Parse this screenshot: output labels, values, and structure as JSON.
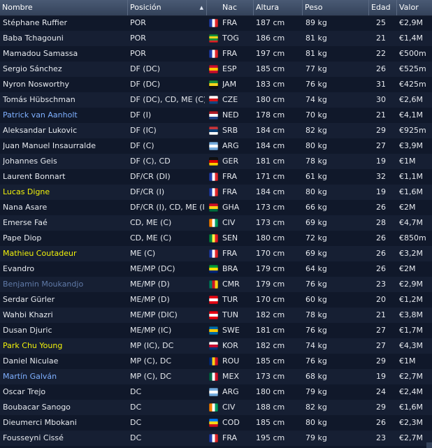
{
  "columns": {
    "name": "Nombre",
    "position": "Posición",
    "nationality": "Nac",
    "height": "Altura",
    "weight": "Peso",
    "age": "Edad",
    "value": "Valor"
  },
  "name_colors": {
    "normal": "#e6e9ee",
    "blue": "#7fb0ff",
    "yellow": "#f2f20a",
    "slate": "#607aa8"
  },
  "players": [
    {
      "name": "Stéphane Ruffier",
      "position": "POR",
      "nation": "FRA",
      "flag": [
        "#1f3da8",
        "#ffffff",
        "#e0262b"
      ],
      "flag_dir": "v",
      "height": "187 cm",
      "weight": "89 kg",
      "age": "25",
      "value": "€2,9M",
      "name_color": "normal"
    },
    {
      "name": "Baba Tchagouni",
      "position": "POR",
      "nation": "TOG",
      "flag": [
        "#1a8f3a",
        "#f6d51c",
        "#1a8f3a",
        "#d8232a"
      ],
      "flag_dir": "h",
      "height": "186 cm",
      "weight": "81 kg",
      "age": "21",
      "value": "€1,4M",
      "name_color": "normal"
    },
    {
      "name": "Mamadou Samassa",
      "position": "POR",
      "nation": "FRA",
      "flag": [
        "#1f3da8",
        "#ffffff",
        "#e0262b"
      ],
      "flag_dir": "v",
      "height": "197 cm",
      "weight": "81 kg",
      "age": "22",
      "value": "€500m",
      "name_color": "normal"
    },
    {
      "name": "Sergio Sánchez",
      "position": "DF (DC)",
      "nation": "ESP",
      "flag": [
        "#c8102e",
        "#ffc400",
        "#c8102e"
      ],
      "flag_dir": "h",
      "height": "185 cm",
      "weight": "77 kg",
      "age": "26",
      "value": "€525m",
      "name_color": "normal"
    },
    {
      "name": "Nyron Nosworthy",
      "position": "DF (DC)",
      "nation": "JAM",
      "flag": [
        "#1a8f3a",
        "#f6d51c",
        "#111111"
      ],
      "flag_dir": "h",
      "height": "183 cm",
      "weight": "76 kg",
      "age": "31",
      "value": "€425m",
      "name_color": "normal"
    },
    {
      "name": "Tomás Hübschman",
      "position": "DF (DC), CD, ME (C)",
      "nation": "CZE",
      "flag": [
        "#ffffff",
        "#d7141a",
        "#11457e"
      ],
      "flag_dir": "h",
      "height": "180 cm",
      "weight": "74 kg",
      "age": "30",
      "value": "€2,6M",
      "name_color": "normal"
    },
    {
      "name": "Patrick van Aanholt",
      "position": "DF (I)",
      "nation": "NED",
      "flag": [
        "#ae1c28",
        "#ffffff",
        "#21468b"
      ],
      "flag_dir": "h",
      "height": "178 cm",
      "weight": "70 kg",
      "age": "21",
      "value": "€4,1M",
      "name_color": "blue"
    },
    {
      "name": "Aleksandar Lukovic",
      "position": "DF (IC)",
      "nation": "SRB",
      "flag": [
        "#c6363c",
        "#0c4076",
        "#ffffff"
      ],
      "flag_dir": "h",
      "height": "184 cm",
      "weight": "82 kg",
      "age": "29",
      "value": "€925m",
      "name_color": "normal"
    },
    {
      "name": "Juan Manuel Insaurralde",
      "position": "DF (C)",
      "nation": "ARG",
      "flag": [
        "#74acdf",
        "#ffffff",
        "#74acdf"
      ],
      "flag_dir": "h",
      "height": "184 cm",
      "weight": "80 kg",
      "age": "27",
      "value": "€3,9M",
      "name_color": "normal"
    },
    {
      "name": "Johannes Geis",
      "position": "DF (C), CD",
      "nation": "GER",
      "flag": [
        "#111111",
        "#dd0000",
        "#ffce00"
      ],
      "flag_dir": "h",
      "height": "181 cm",
      "weight": "78 kg",
      "age": "19",
      "value": "€1M",
      "name_color": "normal"
    },
    {
      "name": "Laurent Bonnart",
      "position": "DF/CR (DI)",
      "nation": "FRA",
      "flag": [
        "#1f3da8",
        "#ffffff",
        "#e0262b"
      ],
      "flag_dir": "v",
      "height": "171 cm",
      "weight": "61 kg",
      "age": "32",
      "value": "€1,1M",
      "name_color": "normal"
    },
    {
      "name": "Lucas Digne",
      "position": "DF/CR (I)",
      "nation": "FRA",
      "flag": [
        "#1f3da8",
        "#ffffff",
        "#e0262b"
      ],
      "flag_dir": "v",
      "height": "184 cm",
      "weight": "80 kg",
      "age": "19",
      "value": "€1,6M",
      "name_color": "yellow"
    },
    {
      "name": "Nana Asare",
      "position": "DF/CR (I), CD, ME (I...",
      "nation": "GHA",
      "flag": [
        "#ce1126",
        "#fcd116",
        "#006b3f"
      ],
      "flag_dir": "h",
      "height": "173 cm",
      "weight": "66 kg",
      "age": "26",
      "value": "€2M",
      "name_color": "normal"
    },
    {
      "name": "Emerse Faé",
      "position": "CD, ME (C)",
      "nation": "CIV",
      "flag": [
        "#f77f00",
        "#ffffff",
        "#009e60"
      ],
      "flag_dir": "v",
      "height": "173 cm",
      "weight": "69 kg",
      "age": "28",
      "value": "€4,7M",
      "name_color": "normal"
    },
    {
      "name": "Pape Diop",
      "position": "CD, ME (C)",
      "nation": "SEN",
      "flag": [
        "#00853f",
        "#fdef42",
        "#e31b23"
      ],
      "flag_dir": "v",
      "height": "180 cm",
      "weight": "72 kg",
      "age": "26",
      "value": "€850m",
      "name_color": "normal"
    },
    {
      "name": "Mathieu Coutadeur",
      "position": "ME (C)",
      "nation": "FRA",
      "flag": [
        "#1f3da8",
        "#ffffff",
        "#e0262b"
      ],
      "flag_dir": "v",
      "height": "170 cm",
      "weight": "69 kg",
      "age": "26",
      "value": "€3,2M",
      "name_color": "yellow"
    },
    {
      "name": "Evandro",
      "position": "ME/MP (DC)",
      "nation": "BRA",
      "flag": [
        "#009c3b",
        "#ffdf00",
        "#002776"
      ],
      "flag_dir": "h",
      "height": "179 cm",
      "weight": "64 kg",
      "age": "26",
      "value": "€2M",
      "name_color": "normal"
    },
    {
      "name": "Benjamin Moukandjo",
      "position": "ME/MP (D)",
      "nation": "CMR",
      "flag": [
        "#007a5e",
        "#ce1126",
        "#fcd116"
      ],
      "flag_dir": "v",
      "height": "179 cm",
      "weight": "76 kg",
      "age": "23",
      "value": "€2,9M",
      "name_color": "slate"
    },
    {
      "name": "Serdar Gürler",
      "position": "ME/MP (D)",
      "nation": "TUR",
      "flag": [
        "#e30a17",
        "#ffffff",
        "#e30a17"
      ],
      "flag_dir": "h",
      "height": "170 cm",
      "weight": "60 kg",
      "age": "20",
      "value": "€1,2M",
      "name_color": "normal"
    },
    {
      "name": "Wahbi Khazri",
      "position": "ME/MP (DIC)",
      "nation": "TUN",
      "flag": [
        "#e70013",
        "#ffffff",
        "#e70013"
      ],
      "flag_dir": "h",
      "height": "182 cm",
      "weight": "78 kg",
      "age": "21",
      "value": "€3,8M",
      "name_color": "normal"
    },
    {
      "name": "Dusan Djuric",
      "position": "ME/MP (IC)",
      "nation": "SWE",
      "flag": [
        "#006aa7",
        "#fecc00",
        "#006aa7"
      ],
      "flag_dir": "h",
      "height": "181 cm",
      "weight": "76 kg",
      "age": "27",
      "value": "€1,7M",
      "name_color": "normal"
    },
    {
      "name": "Park Chu Young",
      "position": "MP (IC), DC",
      "nation": "KOR",
      "flag": [
        "#ffffff",
        "#c60c30",
        "#003478"
      ],
      "flag_dir": "h",
      "height": "182 cm",
      "weight": "74 kg",
      "age": "27",
      "value": "€4,3M",
      "name_color": "yellow"
    },
    {
      "name": "Daniel Niculae",
      "position": "MP (C), DC",
      "nation": "ROU",
      "flag": [
        "#002b7f",
        "#fcd116",
        "#ce1126"
      ],
      "flag_dir": "v",
      "height": "185 cm",
      "weight": "76 kg",
      "age": "29",
      "value": "€1M",
      "name_color": "normal"
    },
    {
      "name": "Martín Galván",
      "position": "MP (C), DC",
      "nation": "MEX",
      "flag": [
        "#006847",
        "#ffffff",
        "#ce1126"
      ],
      "flag_dir": "v",
      "height": "173 cm",
      "weight": "68 kg",
      "age": "19",
      "value": "€2,7M",
      "name_color": "blue"
    },
    {
      "name": "Oscar Trejo",
      "position": "DC",
      "nation": "ARG",
      "flag": [
        "#74acdf",
        "#ffffff",
        "#74acdf"
      ],
      "flag_dir": "h",
      "height": "180 cm",
      "weight": "79 kg",
      "age": "24",
      "value": "€2,4M",
      "name_color": "normal"
    },
    {
      "name": "Boubacar Sanogo",
      "position": "DC",
      "nation": "CIV",
      "flag": [
        "#f77f00",
        "#ffffff",
        "#009e60"
      ],
      "flag_dir": "v",
      "height": "188 cm",
      "weight": "82 kg",
      "age": "29",
      "value": "€1,6M",
      "name_color": "normal"
    },
    {
      "name": "Dieumerci Mbokani",
      "position": "DC",
      "nation": "COD",
      "flag": [
        "#007fff",
        "#f7d618",
        "#ce1021"
      ],
      "flag_dir": "h",
      "height": "185 cm",
      "weight": "80 kg",
      "age": "26",
      "value": "€2,3M",
      "name_color": "normal"
    },
    {
      "name": "Fousseyni Cissé",
      "position": "DC",
      "nation": "FRA",
      "flag": [
        "#1f3da8",
        "#ffffff",
        "#e0262b"
      ],
      "flag_dir": "v",
      "height": "195 cm",
      "weight": "79 kg",
      "age": "23",
      "value": "€2,7M",
      "name_color": "normal"
    }
  ]
}
